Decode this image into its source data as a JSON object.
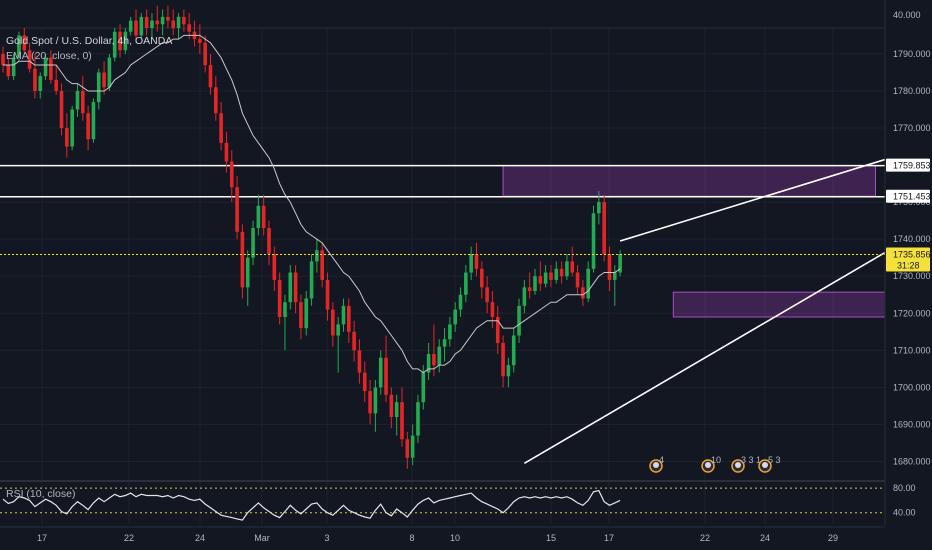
{
  "legend": {
    "symbol": "Gold Spot / U.S. Dollar, 4h, OANDA",
    "ema": "EMA (20, close, 0)",
    "rsi": "RSI (10, close)"
  },
  "colors": {
    "background": "#131722",
    "grid": "#1e222d",
    "up": "#22ab52",
    "down": "#e62626",
    "ema": "#c9c9c9",
    "zone": "#8e3aa8",
    "zone_border": "#a84fc2",
    "line": "#ffffff",
    "current_price": "#f5e13a"
  },
  "price_axis": {
    "ticks": [
      "1790.000",
      "1780.000",
      "1770.000",
      "1750.000",
      "1740.000",
      "1730.000",
      "1720.000",
      "1710.000",
      "1700.000",
      "1690.000",
      "1680.000"
    ],
    "tick_values": [
      1790,
      1780,
      1770,
      1750,
      1740,
      1730,
      1720,
      1710,
      1700,
      1690,
      1680
    ],
    "top_cut": "40.000"
  },
  "rsi_axis": {
    "ticks": [
      "80.00",
      "40.00"
    ],
    "tick_values": [
      80,
      40
    ]
  },
  "price_labels": [
    {
      "text": "1759.853",
      "value": 1759.853,
      "style": "white"
    },
    {
      "text": "1751.453",
      "value": 1751.453,
      "style": "white"
    },
    {
      "text": "1735.856",
      "value": 1735.856,
      "style": "yellow"
    }
  ],
  "countdown": "31:28",
  "time_axis": [
    "17",
    "22",
    "24",
    "Mar",
    "3",
    "8",
    "10",
    "15",
    "17",
    "22",
    "24",
    "29"
  ],
  "events": [
    "4",
    "10",
    "3 3 1",
    "5 3"
  ],
  "chart_data": {
    "type": "candlestick",
    "title": "Gold Spot / U.S. Dollar, 4h, OANDA",
    "ylim": [
      1675,
      1797
    ],
    "rsi_ylim": [
      20,
      90
    ],
    "levels": [
      1759.853,
      1751.453
    ],
    "current_price": 1735.856,
    "zones": [
      {
        "start": 94,
        "end": 164,
        "top": 1759.9,
        "bottom": 1751.6
      },
      {
        "start": 126,
        "end": 205,
        "top": 1725.7,
        "bottom": 1719.0
      }
    ],
    "trendlines": [
      {
        "from": [
          98,
          1679.5
        ],
        "to": [
          182,
          1750.0
        ]
      },
      {
        "from": [
          116,
          1739.5
        ],
        "to": [
          176,
          1766.0
        ]
      }
    ],
    "candles": [
      [
        1790,
        1792,
        1785,
        1787
      ],
      [
        1787,
        1789,
        1783,
        1784
      ],
      [
        1784,
        1790,
        1783,
        1789
      ],
      [
        1789,
        1796,
        1788,
        1795
      ],
      [
        1795,
        1797,
        1790,
        1791
      ],
      [
        1791,
        1793,
        1785,
        1786
      ],
      [
        1786,
        1790,
        1778,
        1780
      ],
      [
        1780,
        1785,
        1778,
        1784
      ],
      [
        1784,
        1790,
        1783,
        1789
      ],
      [
        1789,
        1791,
        1782,
        1783
      ],
      [
        1783,
        1787,
        1779,
        1780
      ],
      [
        1780,
        1782,
        1768,
        1770
      ],
      [
        1770,
        1774,
        1762,
        1765
      ],
      [
        1765,
        1776,
        1764,
        1775
      ],
      [
        1775,
        1782,
        1773,
        1780
      ],
      [
        1780,
        1784,
        1772,
        1774
      ],
      [
        1774,
        1776,
        1764,
        1767
      ],
      [
        1767,
        1778,
        1766,
        1777
      ],
      [
        1777,
        1786,
        1775,
        1785
      ],
      [
        1785,
        1788,
        1779,
        1781
      ],
      [
        1781,
        1790,
        1780,
        1789
      ],
      [
        1789,
        1797,
        1788,
        1796
      ],
      [
        1796,
        1798,
        1789,
        1791
      ],
      [
        1791,
        1797,
        1790,
        1796
      ],
      [
        1796,
        1800,
        1795,
        1799
      ],
      [
        1799,
        1802,
        1793,
        1795
      ],
      [
        1795,
        1801,
        1794,
        1800
      ],
      [
        1800,
        1802,
        1795,
        1797
      ],
      [
        1797,
        1801,
        1794,
        1799
      ],
      [
        1799,
        1803,
        1796,
        1798
      ],
      [
        1798,
        1802,
        1795,
        1800
      ],
      [
        1800,
        1803,
        1797,
        1799
      ],
      [
        1799,
        1802,
        1795,
        1797
      ],
      [
        1797,
        1801,
        1794,
        1800
      ],
      [
        1800,
        1802,
        1796,
        1798
      ],
      [
        1798,
        1801,
        1794,
        1796
      ],
      [
        1796,
        1799,
        1792,
        1794
      ],
      [
        1794,
        1798,
        1790,
        1793
      ],
      [
        1793,
        1795,
        1785,
        1787
      ],
      [
        1787,
        1790,
        1779,
        1781
      ],
      [
        1781,
        1784,
        1772,
        1774
      ],
      [
        1774,
        1777,
        1764,
        1766
      ],
      [
        1766,
        1769,
        1758,
        1761
      ],
      [
        1761,
        1764,
        1750,
        1754
      ],
      [
        1754,
        1757,
        1740,
        1742
      ],
      [
        1742,
        1744,
        1724,
        1727
      ],
      [
        1727,
        1737,
        1722,
        1735
      ],
      [
        1735,
        1745,
        1733,
        1743
      ],
      [
        1743,
        1752,
        1741,
        1749
      ],
      [
        1749,
        1752,
        1741,
        1743
      ],
      [
        1743,
        1745,
        1733,
        1736
      ],
      [
        1736,
        1738,
        1726,
        1729
      ],
      [
        1729,
        1731,
        1717,
        1719
      ],
      [
        1719,
        1725,
        1710,
        1723
      ],
      [
        1723,
        1733,
        1721,
        1731
      ],
      [
        1731,
        1733,
        1720,
        1723
      ],
      [
        1723,
        1725,
        1713,
        1716
      ],
      [
        1716,
        1726,
        1714,
        1724
      ],
      [
        1724,
        1736,
        1722,
        1734
      ],
      [
        1734,
        1740,
        1731,
        1737
      ],
      [
        1737,
        1739,
        1727,
        1729
      ],
      [
        1729,
        1731,
        1718,
        1721
      ],
      [
        1721,
        1723,
        1711,
        1714
      ],
      [
        1714,
        1719,
        1704,
        1717
      ],
      [
        1717,
        1724,
        1715,
        1722
      ],
      [
        1722,
        1724,
        1712,
        1715
      ],
      [
        1715,
        1718,
        1707,
        1710
      ],
      [
        1710,
        1713,
        1701,
        1704
      ],
      [
        1704,
        1707,
        1696,
        1699
      ],
      [
        1699,
        1702,
        1690,
        1693
      ],
      [
        1693,
        1702,
        1688,
        1700
      ],
      [
        1700,
        1710,
        1698,
        1708
      ],
      [
        1708,
        1714,
        1696,
        1698
      ],
      [
        1698,
        1700,
        1689,
        1692
      ],
      [
        1692,
        1698,
        1687,
        1696
      ],
      [
        1696,
        1700,
        1684,
        1686
      ],
      [
        1686,
        1688,
        1678,
        1681
      ],
      [
        1681,
        1690,
        1679,
        1687
      ],
      [
        1687,
        1698,
        1685,
        1696
      ],
      [
        1696,
        1706,
        1694,
        1704
      ],
      [
        1704,
        1712,
        1702,
        1709
      ],
      [
        1709,
        1717,
        1703,
        1706
      ],
      [
        1706,
        1713,
        1704,
        1711
      ],
      [
        1711,
        1716,
        1707,
        1713
      ],
      [
        1713,
        1719,
        1711,
        1717
      ],
      [
        1717,
        1723,
        1715,
        1721
      ],
      [
        1721,
        1727,
        1719,
        1725
      ],
      [
        1725,
        1733,
        1723,
        1731
      ],
      [
        1731,
        1738,
        1729,
        1736
      ],
      [
        1736,
        1739,
        1730,
        1732
      ],
      [
        1732,
        1734,
        1724,
        1727
      ],
      [
        1727,
        1730,
        1720,
        1723
      ],
      [
        1723,
        1726,
        1716,
        1719
      ],
      [
        1719,
        1722,
        1709,
        1712
      ],
      [
        1712,
        1714,
        1700,
        1703
      ],
      [
        1703,
        1708,
        1700,
        1706
      ],
      [
        1706,
        1716,
        1704,
        1714
      ],
      [
        1714,
        1724,
        1712,
        1722
      ],
      [
        1722,
        1729,
        1720,
        1727
      ],
      [
        1727,
        1731,
        1724,
        1726
      ],
      [
        1726,
        1732,
        1725,
        1730
      ],
      [
        1730,
        1734,
        1726,
        1728
      ],
      [
        1728,
        1733,
        1727,
        1731
      ],
      [
        1731,
        1733,
        1727,
        1729
      ],
      [
        1729,
        1734,
        1728,
        1732
      ],
      [
        1732,
        1734,
        1728,
        1730
      ],
      [
        1730,
        1736,
        1729,
        1734
      ],
      [
        1734,
        1738,
        1730,
        1731
      ],
      [
        1731,
        1733,
        1725,
        1727
      ],
      [
        1727,
        1729,
        1722,
        1724
      ],
      [
        1724,
        1734,
        1723,
        1732
      ],
      [
        1732,
        1749,
        1731,
        1747
      ],
      [
        1747,
        1753,
        1744,
        1750
      ],
      [
        1750,
        1752,
        1734,
        1736
      ],
      [
        1736,
        1738,
        1726,
        1729
      ],
      [
        1729,
        1733,
        1722,
        1731
      ],
      [
        1731,
        1737,
        1730,
        1736
      ]
    ],
    "ema": [
      1787,
      1787,
      1787,
      1788,
      1788,
      1788,
      1787,
      1787,
      1787,
      1787,
      1787,
      1785,
      1783,
      1782,
      1782,
      1781,
      1780,
      1780,
      1780,
      1780,
      1781,
      1783,
      1784,
      1785,
      1787,
      1788,
      1789,
      1790,
      1791,
      1792,
      1793,
      1793,
      1794,
      1794,
      1795,
      1795,
      1795,
      1795,
      1794,
      1793,
      1791,
      1789,
      1786,
      1783,
      1779,
      1774,
      1771,
      1768,
      1766,
      1764,
      1762,
      1759,
      1755,
      1752,
      1750,
      1747,
      1744,
      1742,
      1741,
      1740,
      1739,
      1737,
      1735,
      1733,
      1731,
      1730,
      1728,
      1726,
      1723,
      1721,
      1719,
      1718,
      1716,
      1714,
      1712,
      1710,
      1707,
      1705,
      1705,
      1704,
      1705,
      1705,
      1706,
      1706,
      1707,
      1709,
      1710,
      1712,
      1714,
      1716,
      1717,
      1718,
      1718,
      1718,
      1716,
      1716,
      1716,
      1717,
      1718,
      1719,
      1720,
      1721,
      1722,
      1723,
      1723,
      1724,
      1725,
      1725,
      1725,
      1725,
      1726,
      1728,
      1730,
      1731,
      1731,
      1731,
      1732
    ],
    "rsi": [
      62,
      55,
      58,
      66,
      64,
      60,
      50,
      56,
      62,
      58,
      52,
      42,
      38,
      50,
      58,
      52,
      45,
      56,
      64,
      58,
      64,
      70,
      66,
      68,
      72,
      66,
      70,
      68,
      68,
      68,
      66,
      68,
      64,
      68,
      66,
      62,
      60,
      62,
      54,
      48,
      42,
      36,
      34,
      32,
      30,
      28,
      40,
      48,
      56,
      48,
      42,
      36,
      32,
      42,
      52,
      44,
      38,
      46,
      54,
      56,
      46,
      40,
      36,
      44,
      52,
      44,
      40,
      36,
      33,
      31,
      44,
      54,
      40,
      35,
      46,
      40,
      33,
      44,
      54,
      60,
      64,
      56,
      60,
      62,
      64,
      66,
      68,
      70,
      72,
      64,
      58,
      54,
      50,
      46,
      40,
      48,
      58,
      64,
      66,
      64,
      66,
      64,
      66,
      64,
      66,
      64,
      66,
      62,
      56,
      52,
      60,
      74,
      76,
      58,
      52,
      56,
      60
    ]
  }
}
